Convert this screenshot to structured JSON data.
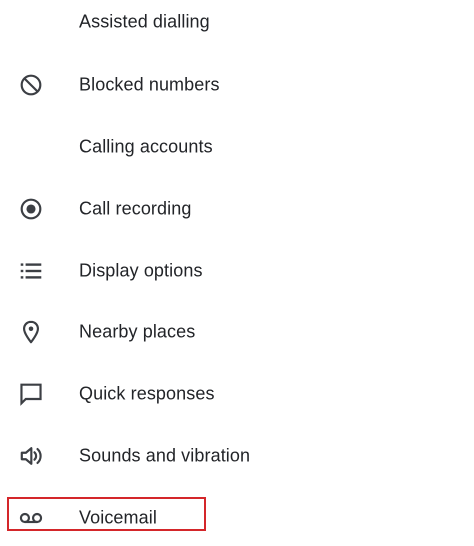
{
  "settings": {
    "items": [
      {
        "label": "Assisted dialling",
        "icon": "none"
      },
      {
        "label": "Blocked numbers",
        "icon": "block-icon"
      },
      {
        "label": "Calling accounts",
        "icon": "none"
      },
      {
        "label": "Call recording",
        "icon": "record-icon"
      },
      {
        "label": "Display options",
        "icon": "list-icon"
      },
      {
        "label": "Nearby places",
        "icon": "location-pin-icon"
      },
      {
        "label": "Quick responses",
        "icon": "chat-bubble-icon"
      },
      {
        "label": "Sounds and vibration",
        "icon": "volume-icon"
      },
      {
        "label": "Voicemail",
        "icon": "voicemail-icon"
      }
    ],
    "highlighted_item": "Voicemail",
    "highlight_color": "#d4262a"
  }
}
